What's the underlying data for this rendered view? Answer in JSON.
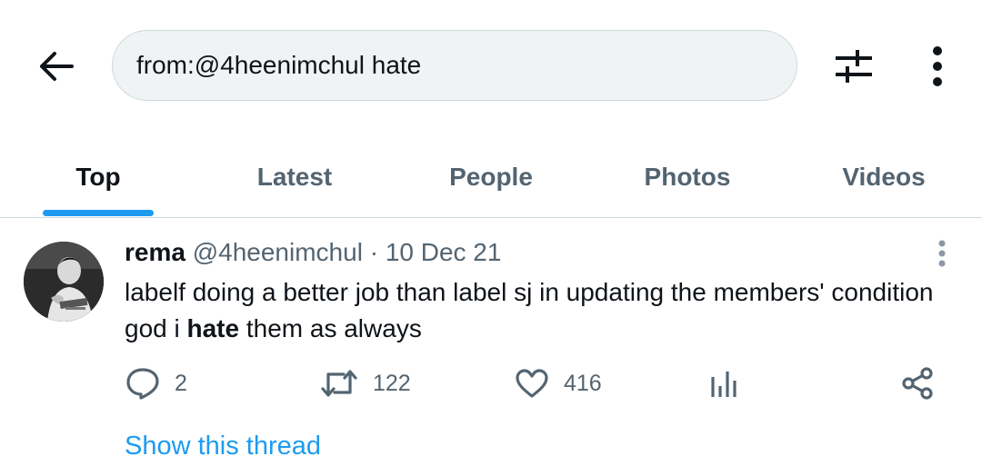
{
  "search": {
    "query": "from:@4heenimchul hate"
  },
  "icons": {
    "back": "arrow-left-icon",
    "filter": "sliders-icon",
    "more": "vertical-dots-icon",
    "reply": "speech-bubble-icon",
    "retweet": "retweet-icon",
    "like": "heart-icon",
    "views": "bar-chart-icon",
    "share": "share-icon"
  },
  "tabs": [
    {
      "label": "Top",
      "active": true
    },
    {
      "label": "Latest",
      "active": false
    },
    {
      "label": "People",
      "active": false
    },
    {
      "label": "Photos",
      "active": false
    },
    {
      "label": "Videos",
      "active": false
    }
  ],
  "tweet": {
    "author": "rema",
    "handle": "@4heenimchul",
    "separator": "·",
    "date": "10 Dec 21",
    "text_before": "labelf doing a better job than label sj in updating the members' condition god i ",
    "text_bold": "hate",
    "text_after": " them as always",
    "replies": "2",
    "retweets": "122",
    "likes": "416",
    "show_thread": "Show this thread"
  },
  "colors": {
    "accent": "#1d9bf0",
    "text": "#0f1419",
    "secondary": "#536471",
    "border": "#cfd9de",
    "search_bg": "#eff3f4"
  }
}
